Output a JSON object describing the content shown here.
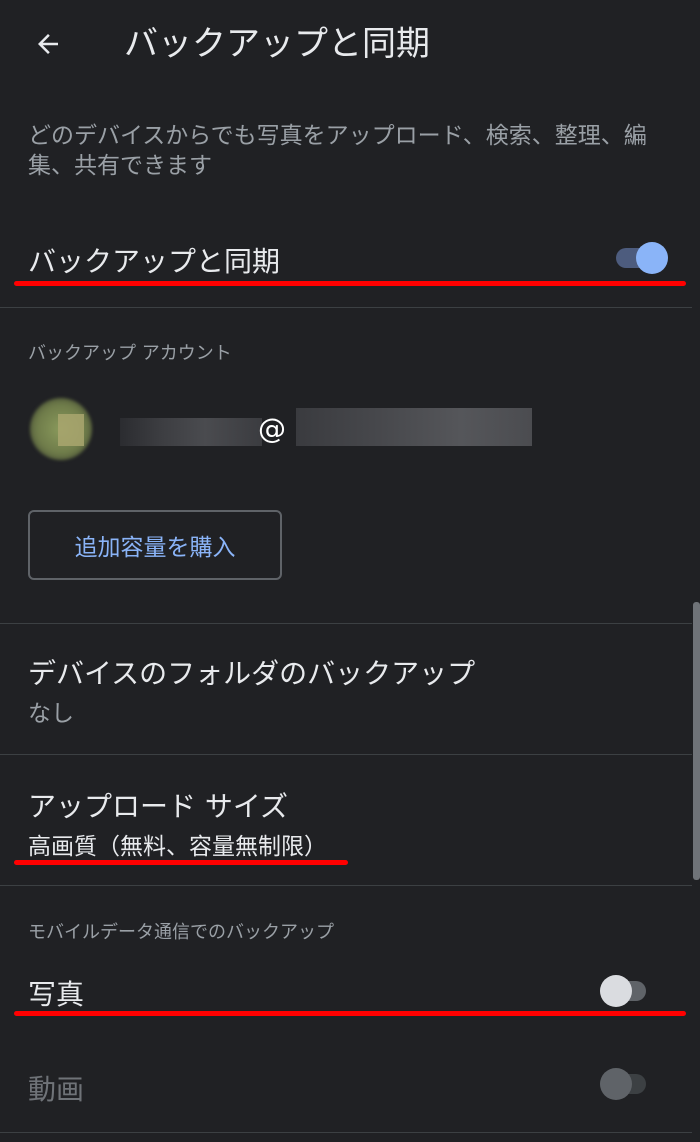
{
  "header": {
    "back_icon": "arrow-left-icon",
    "title": "バックアップと同期"
  },
  "description": "どのデバイスからでも写真をアップロード、検索、整理、編集、共有できます",
  "backup_sync": {
    "label": "バックアップと同期",
    "enabled": true
  },
  "account": {
    "section_header": "バックアップ アカウント",
    "email": "@",
    "buy_storage_label": "追加容量を購入"
  },
  "device_folders": {
    "title": "デバイスのフォルダのバックアップ",
    "value": "なし"
  },
  "upload_size": {
    "title": "アップロード サイズ",
    "value": "高画質（無料、容量無制限）"
  },
  "mobile_data": {
    "section_header": "モバイルデータ通信でのバックアップ",
    "photos_label": "写真",
    "photos_enabled": false,
    "videos_label": "動画",
    "videos_enabled": false,
    "videos_disabled": true
  },
  "colors": {
    "background": "#202124",
    "accent": "#8ab4f8",
    "annotation": "#ff0000"
  }
}
